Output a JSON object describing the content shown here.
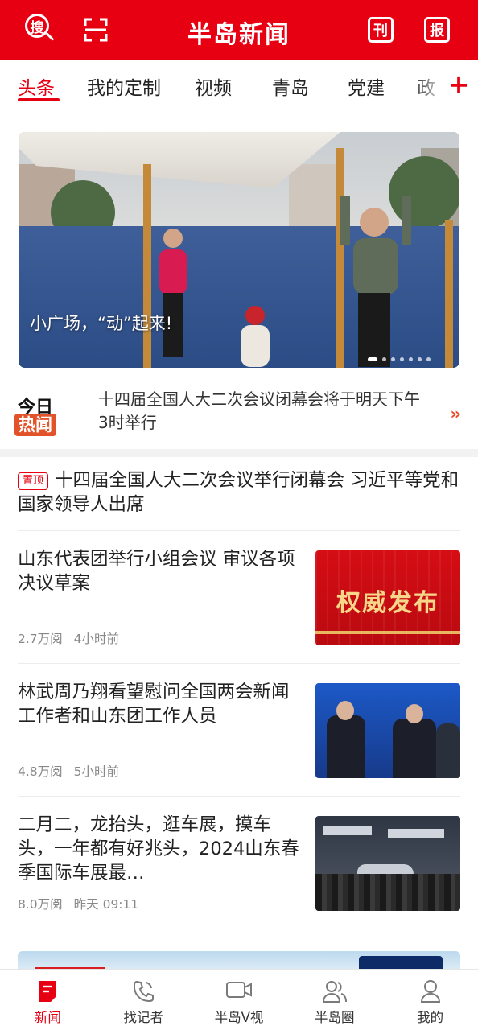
{
  "header": {
    "brand": "半岛新闻",
    "search_icon_char": "搜",
    "journal_icon_char": "刊",
    "newspaper_icon_char": "报",
    "color": "#e60012"
  },
  "tabs": [
    {
      "label": "头条",
      "active": true
    },
    {
      "label": "我的定制"
    },
    {
      "label": "视频"
    },
    {
      "label": "青岛"
    },
    {
      "label": "党建"
    },
    {
      "label": "政"
    }
  ],
  "banner": {
    "caption": "小广场，“动”起来!",
    "slide_count": 7,
    "active_slide": 1
  },
  "hot_news": {
    "logo_top": "今日",
    "logo_bottom": "热闻",
    "headline": "十四届全国人大二次会议闭幕会将于明天下午3时举行",
    "arrow": "››"
  },
  "pinned": {
    "tag": "置顶",
    "title": "十四届全国人大二次会议举行闭幕会 习近平等党和国家领导人出席"
  },
  "news": [
    {
      "title": "山东代表团举行小组会议 审议各项决议草案",
      "reads": "2.7万阅",
      "time": "4小时前",
      "thumb_text": "权威发布"
    },
    {
      "title": "林武周乃翔看望慰问全国两会新闻工作者和山东团工作人员",
      "reads": "4.8万阅",
      "time": "5小时前"
    },
    {
      "title": "二月二，龙抬头，逛车展，摸车头，一年都有好兆头，2024山东春季国际车展最…",
      "reads": "8.0万阅",
      "time": "昨天 09:11"
    }
  ],
  "bottom_nav": [
    {
      "label": "新闻",
      "icon": "news-icon",
      "active": true
    },
    {
      "label": "找记者",
      "icon": "phone-icon"
    },
    {
      "label": "半岛V视",
      "icon": "video-icon"
    },
    {
      "label": "半岛圈",
      "icon": "community-icon"
    },
    {
      "label": "我的",
      "icon": "profile-icon"
    }
  ],
  "colors": {
    "accent": "#e60012",
    "meta": "#888888",
    "hot_badge": "#e2532a"
  }
}
